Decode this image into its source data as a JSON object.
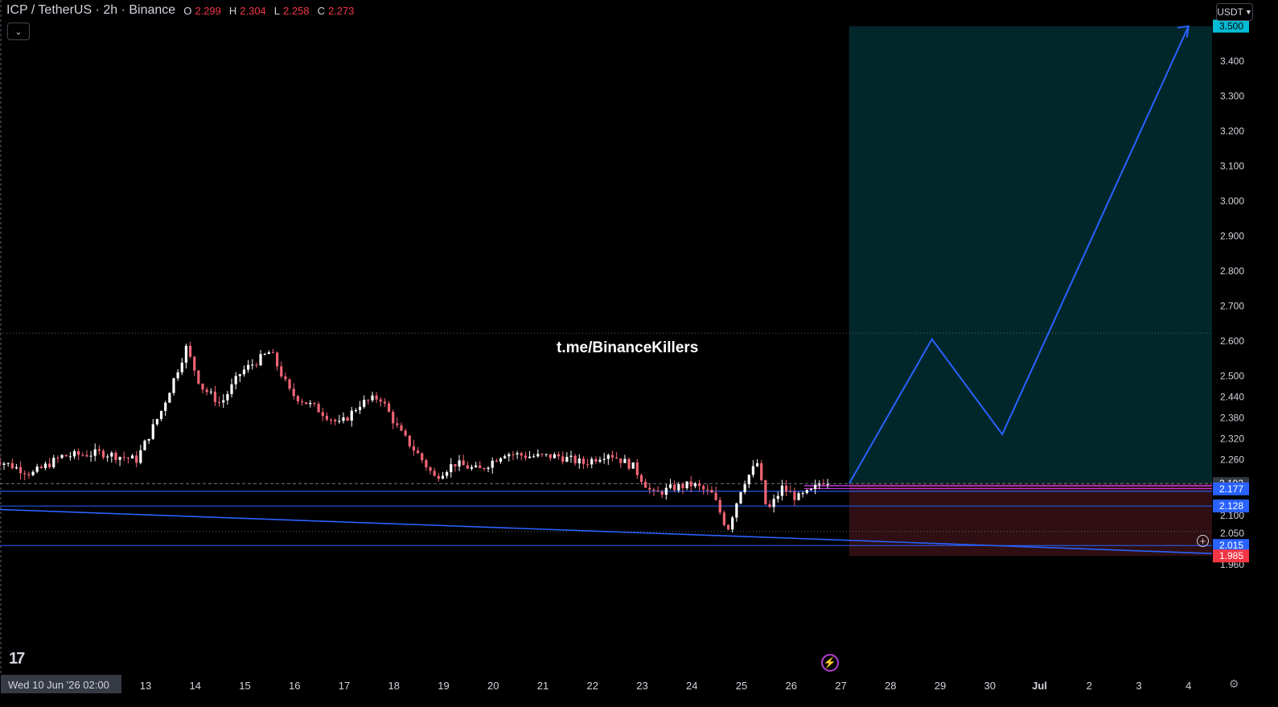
{
  "header": {
    "symbol": "ICP / TetherUS · 2h · Binance",
    "open_label": "O",
    "open": "2.299",
    "high_label": "H",
    "high": "2.304",
    "low_label": "L",
    "low": "2.258",
    "close_label": "C",
    "close": "2.273"
  },
  "currency_button": "USDT",
  "watermark": "t.me/BinanceKillers",
  "logo_text": "17",
  "colors": {
    "bull": "#ffffff",
    "bear": "#f06575",
    "projection": "#2962ff",
    "target_zone": "#02272b",
    "stop_zone": "#2f0f13",
    "label_blue": "#2962ff",
    "label_red": "#f23645",
    "label_cyan": "#00bcd4",
    "label_gray": "#363a45"
  },
  "chart_data": {
    "type": "candlestick",
    "ylim": [
      1.96,
      3.55
    ],
    "y_ticks": [
      "3.400",
      "3.300",
      "3.200",
      "3.100",
      "3.000",
      "2.900",
      "2.800",
      "2.700",
      "2.600",
      "2.500",
      "2.440",
      "2.380",
      "2.320",
      "2.260",
      "2.100",
      "2.050",
      "1.960"
    ],
    "x_ticks": [
      "13",
      "14",
      "15",
      "16",
      "17",
      "18",
      "19",
      "20",
      "21",
      "22",
      "23",
      "24",
      "25",
      "26",
      "27",
      "28",
      "29",
      "30",
      "Jul",
      "2",
      "3",
      "4"
    ],
    "crosshair_date": "Wed 10 Jun '26   02:00",
    "price_labels": [
      {
        "text": "3.500",
        "value": 3.5,
        "color": "cyan"
      },
      {
        "text": "2.192",
        "value": 2.192,
        "color": "gray"
      },
      {
        "text": "2.177",
        "value": 2.177,
        "color": "blue"
      },
      {
        "text": "2.128",
        "value": 2.128,
        "color": "blue"
      },
      {
        "text": "2.015",
        "value": 2.015,
        "color": "blue"
      },
      {
        "text": "1.985",
        "value": 1.985,
        "color": "red"
      }
    ],
    "horizontal_levels": [
      2.128,
      2.015
    ],
    "dotted_levels": [
      2.622,
      2.055
    ],
    "dashed_level": 2.192,
    "entry_band": [
      2.17,
      2.186
    ],
    "trendline": {
      "from": 2.118,
      "to": 1.992
    },
    "trade_zone": {
      "entry": 2.192,
      "target": 3.5,
      "stop": 1.985
    },
    "projection_path": [
      {
        "date": "Jun 27 04:00",
        "price": 2.192
      },
      {
        "date": "Jun 28 20:00",
        "price": 2.605
      },
      {
        "date": "Jun 30 06:00",
        "price": 2.333
      },
      {
        "date": "Jul 4 00:00",
        "price": 3.5
      }
    ],
    "ohlc_summary": {
      "start": "2.27",
      "range_low": "2.04",
      "range_high": "2.62",
      "last": "2.273"
    }
  }
}
